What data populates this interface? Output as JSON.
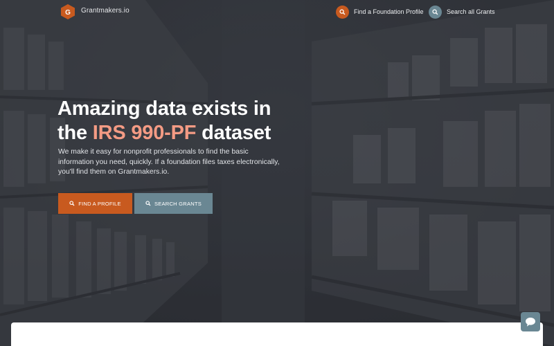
{
  "brand": {
    "name": "Grantmakers.io",
    "logo_letter": "G"
  },
  "nav": {
    "find_profile": {
      "label": "Find a Foundation Profile",
      "icon": "search-icon",
      "color": "#c85a1f"
    },
    "search_grants": {
      "label": "Search all Grants",
      "icon": "search-icon",
      "color": "#6a8793"
    }
  },
  "hero": {
    "headline_line1": "Amazing data exists in",
    "headline_pre": "the ",
    "headline_accent": "IRS 990-PF",
    "headline_post": " dataset",
    "lede": "We make it easy for nonprofit professionals to find the basic information you need, quickly. If a foundation files taxes electronically, you'll find them on Grantmakers.io.",
    "cta_primary": "FIND A PROFILE",
    "cta_secondary": "SEARCH GRANTS"
  },
  "colors": {
    "accent": "#f49b84",
    "primary": "#c85a1f",
    "secondary": "#6a8793"
  },
  "chat": {
    "icon": "chat-icon"
  }
}
